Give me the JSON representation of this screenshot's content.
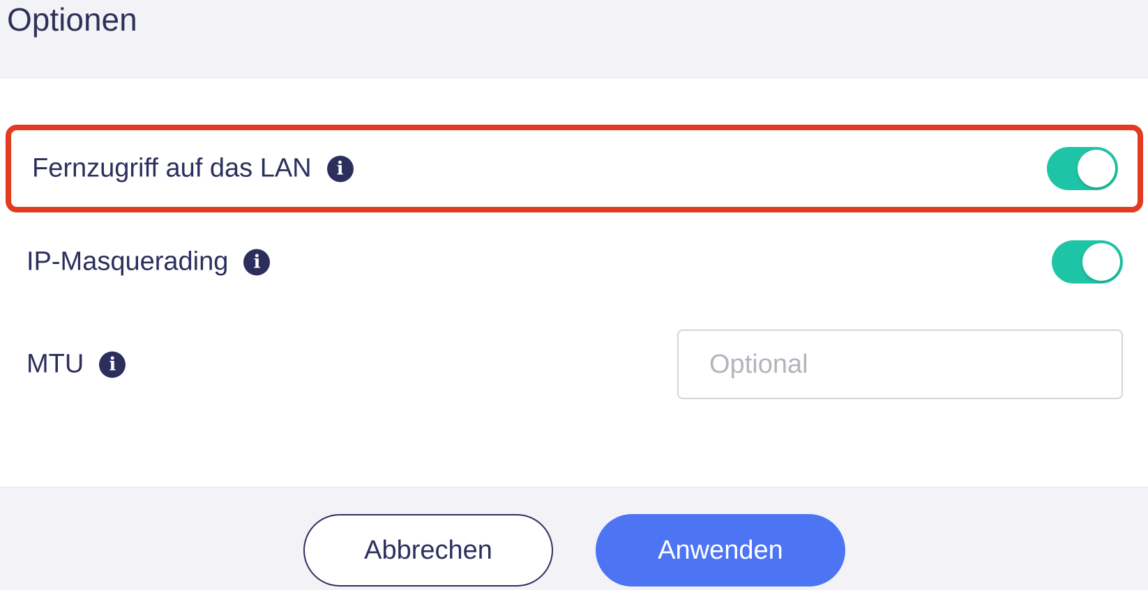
{
  "dialog": {
    "title": "Optionen"
  },
  "options": [
    {
      "label": "Fernzugriff auf das LAN",
      "info_icon": "info-icon",
      "type": "toggle",
      "checked": true,
      "highlighted": true
    },
    {
      "label": "IP-Masquerading",
      "info_icon": "info-icon",
      "type": "toggle",
      "checked": true,
      "highlighted": false
    },
    {
      "label": "MTU",
      "info_icon": "info-icon",
      "type": "input",
      "value": "",
      "placeholder": "Optional"
    }
  ],
  "footer": {
    "cancel_label": "Abbrechen",
    "apply_label": "Anwenden"
  },
  "colors": {
    "toggle_on": "#1ec4a6",
    "primary": "#4d74f3",
    "text": "#2c2f5c",
    "highlight": "#e23b1f"
  }
}
